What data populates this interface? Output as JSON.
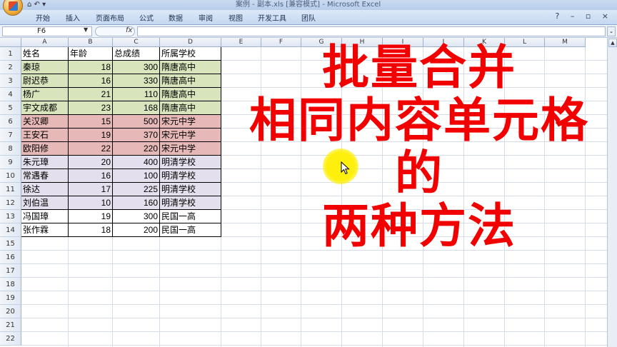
{
  "window": {
    "title": "案例 - 副本.xls [兼容模式] - Microsoft Excel",
    "quick_access": "⌂ ↶ ▾"
  },
  "ribbon": {
    "tabs": [
      "开始",
      "插入",
      "页面布局",
      "公式",
      "数据",
      "审阅",
      "视图",
      "开发工具",
      "团队"
    ],
    "right_icons": "? – ▫ ×"
  },
  "formula_bar": {
    "name_box": "F6",
    "fx_label": "fx",
    "formula": ""
  },
  "sheet": {
    "columns": [
      "A",
      "B",
      "C",
      "D",
      "E",
      "F",
      "G",
      "H",
      "I",
      "J",
      "K",
      "L",
      "M"
    ],
    "row_numbers": [
      "1",
      "2",
      "3",
      "4",
      "5",
      "6",
      "7",
      "8",
      "9",
      "10",
      "11",
      "12",
      "13",
      "14",
      "15",
      "16",
      "17",
      "18",
      "19",
      "20",
      "21",
      "22"
    ],
    "header": [
      "姓名",
      "年龄",
      "总成绩",
      "所属学校"
    ],
    "rows": [
      {
        "name": "秦琼",
        "age": "18",
        "score": "300",
        "school": "隋唐高中",
        "fill": "#d8e4bc"
      },
      {
        "name": "尉迟恭",
        "age": "16",
        "score": "330",
        "school": "隋唐高中",
        "fill": "#d8e4bc"
      },
      {
        "name": "杨广",
        "age": "21",
        "score": "110",
        "school": "隋唐高中",
        "fill": "#d8e4bc"
      },
      {
        "name": "宇文成都",
        "age": "23",
        "score": "168",
        "school": "隋唐高中",
        "fill": "#d8e4bc"
      },
      {
        "name": "关汉卿",
        "age": "15",
        "score": "500",
        "school": "宋元中学",
        "fill": "#e6b8b7"
      },
      {
        "name": "王安石",
        "age": "19",
        "score": "370",
        "school": "宋元中学",
        "fill": "#e6b8b7"
      },
      {
        "name": "欧阳修",
        "age": "22",
        "score": "220",
        "school": "宋元中学",
        "fill": "#e6b8b7"
      },
      {
        "name": "朱元璋",
        "age": "20",
        "score": "400",
        "school": "明清学校",
        "fill": "#e4dfec"
      },
      {
        "name": "常遇春",
        "age": "16",
        "score": "100",
        "school": "明清学校",
        "fill": "#e4dfec"
      },
      {
        "name": "徐达",
        "age": "17",
        "score": "225",
        "school": "明清学校",
        "fill": "#e4dfec"
      },
      {
        "name": "刘伯温",
        "age": "10",
        "score": "160",
        "school": "明清学校",
        "fill": "#e4dfec"
      },
      {
        "name": "冯国璋",
        "age": "19",
        "score": "300",
        "school": "民国一高",
        "fill": "#ffffff"
      },
      {
        "name": "张作霖",
        "age": "18",
        "score": "200",
        "school": "民国一高",
        "fill": "#ffffff"
      }
    ]
  },
  "overlay": {
    "lines": [
      "批量合并",
      "相同内容单元格",
      "的",
      "两种方法"
    ],
    "color": "#f20000"
  }
}
